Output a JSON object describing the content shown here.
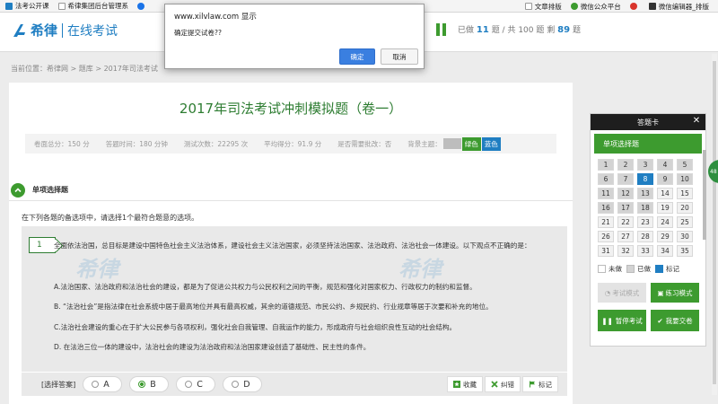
{
  "bookmarks": [
    {
      "label": "法考公开课",
      "color": "#1f7ec2"
    },
    {
      "label": "希律集团后台管理系",
      "color": "#ffffff"
    },
    {
      "label": "",
      "color": "#1a73e8"
    }
  ],
  "bookmarks_right": [
    {
      "label": "文章排版",
      "color": "#1f7ec2"
    },
    {
      "label": "微信公众平台",
      "color": "#3d9b2f"
    },
    {
      "label": "",
      "color": "#d9342b"
    },
    {
      "label": "微信编辑器_排版",
      "color": "#333333"
    }
  ],
  "header": {
    "logo_text": "希律",
    "logo_sub": "在线考试",
    "progress_done_label": "已做",
    "progress_done": "11",
    "progress_sep": "题 / 共",
    "progress_total": "100",
    "progress_remain_label": "题 剩",
    "progress_remain": "89",
    "progress_tail": "题"
  },
  "breadcrumb": "当前位置：希律网 > 题库 > 2017年司法考试",
  "exam": {
    "title": "2017年司法考试冲刺模拟题（卷一）",
    "info": [
      "卷面总分：150 分",
      "答题时间：180 分钟",
      "测试次数：22295 次",
      "平均得分：91.9 分",
      "是否需要批改：否",
      "背景主题："
    ],
    "themes": [
      "绿色",
      "蓝色"
    ]
  },
  "section": {
    "title": "单项选择题",
    "instruction": "在下列各题的备选项中，请选择1个最符合题意的选项。"
  },
  "question": {
    "number": "1",
    "text": "全面依法治国，总目标是建设中国特色社会主义法治体系，建设社会主义法治国家，必须坚持法治国家、法治政府、法治社会一体建设。以下观点不正确的是：",
    "options": [
      "A.法治国家、法治政府和法治社会的建设，都是为了促进公共权力与公民权利之间的平衡，规范和强化对国家权力、行政权力的制约和监督。",
      "B. “法治社会”是指法律在社会系统中居于最高地位并具有最高权威，其余的道德规范、市民公约、乡规民约、行业规章等居于次要和补充的地位。",
      "C.法治社会建设的重心在于扩大公民参与各项权利，强化社会自我管理、自我运作的能力，形成政府与社会组织良性互动的社会结构。",
      "D. 在法治三位一体的建设中，法治社会的建设为法治政府和法治国家建设创造了基础性、民主性的条件。"
    ],
    "watermark": "希律"
  },
  "answer": {
    "label": "[选择答案]",
    "choices": [
      "A",
      "B",
      "C",
      "D"
    ],
    "selected": "B",
    "tools": [
      "收藏",
      "纠错",
      "标记"
    ]
  },
  "card": {
    "title": "答题卡",
    "section": "单项选择题",
    "numbers": [
      "1",
      "2",
      "3",
      "4",
      "5",
      "6",
      "7",
      "8",
      "9",
      "10",
      "11",
      "12",
      "13",
      "14",
      "15",
      "16",
      "17",
      "18",
      "19",
      "20",
      "21",
      "22",
      "23",
      "24",
      "25",
      "26",
      "27",
      "28",
      "29",
      "30",
      "31",
      "32",
      "33",
      "34",
      "35"
    ],
    "done": [
      "1",
      "2",
      "3",
      "4",
      "5",
      "6",
      "7",
      "9",
      "10",
      "11",
      "12",
      "13",
      "16",
      "17",
      "18"
    ],
    "current": "8",
    "legend": [
      "未做",
      "已做",
      "标记"
    ],
    "mode_exam": "考试模式",
    "mode_practice": "练习模式",
    "pause": "暂停考试",
    "submit": "我要交卷"
  },
  "side_tab": "48",
  "dialog": {
    "title": "www.xilvlaw.com 显示",
    "message": "确定提交试卷??",
    "ok": "确定",
    "cancel": "取消"
  },
  "colors": {
    "accent_green": "#3d9b2f",
    "accent_blue": "#1f7ec2"
  }
}
